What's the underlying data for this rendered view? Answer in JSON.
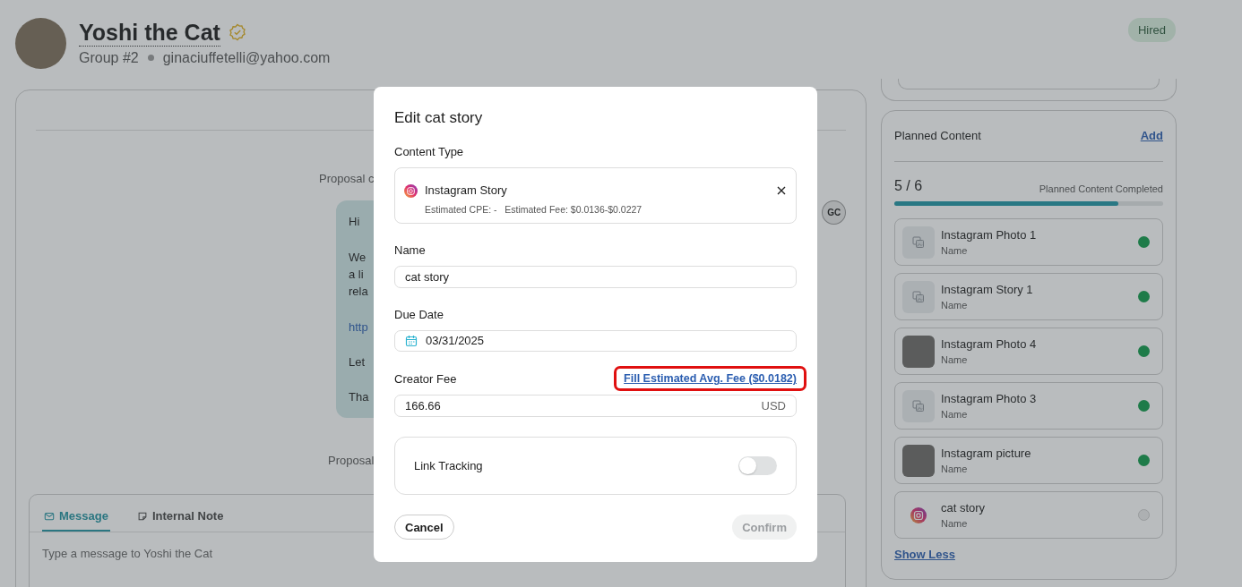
{
  "profile": {
    "name": "Yoshi the Cat",
    "verified": true,
    "group": "Group #2",
    "email": "ginaciuffetelli@yahoo.com",
    "status": "Hired"
  },
  "chat": {
    "event_top": "Proposal c",
    "bubble_lines": [
      "Hi",
      "We",
      "a li",
      "rela",
      "http",
      "Let",
      "Tha"
    ],
    "sender_initials": "GC",
    "event_bottom": "Proposal"
  },
  "composer": {
    "tabs": [
      {
        "label": "Message",
        "kind": "message",
        "selected": true
      },
      {
        "label": "Internal Note",
        "kind": "note",
        "selected": false
      }
    ],
    "placeholder": "Type a message to Yoshi the Cat"
  },
  "planned_content": {
    "title": "Planned Content",
    "add_link": "Add",
    "count": "5 / 6",
    "caption": "Planned Content Completed",
    "level": 0.833,
    "items": [
      {
        "title": "Instagram Photo 1",
        "subtitle": "Name",
        "kind": "placeholder",
        "completed": true
      },
      {
        "title": "Instagram Story 1",
        "subtitle": "Name",
        "kind": "placeholder",
        "completed": true
      },
      {
        "title": "Instagram Photo 4",
        "subtitle": "Name",
        "kind": "photo",
        "completed": true
      },
      {
        "title": "Instagram Photo 3",
        "subtitle": "Name",
        "kind": "placeholder",
        "completed": true
      },
      {
        "title": "Instagram picture",
        "subtitle": "Name",
        "kind": "photo",
        "completed": true
      },
      {
        "title": "cat story",
        "subtitle": "Name",
        "kind": "instagram",
        "completed": false
      }
    ],
    "toggle_link": "Show Less"
  },
  "modal": {
    "title": "Edit cat story",
    "content_type_label": "Content Type",
    "content_type": "Instagram Story",
    "estimate": "Estimated CPE: -   Estimated Fee: $0.0136-$0.0227",
    "name_label": "Name",
    "name_value": "cat story",
    "due_label": "Due Date",
    "due_value": "03/31/2025",
    "fee_label": "Creator Fee",
    "fee_link": "Fill Estimated Avg. Fee ($0.0182)",
    "fee_link_highlighted": true,
    "fee_value": "166.66",
    "currency": "USD",
    "link_tracking_label": "Link Tracking",
    "link_tracking_on": false,
    "cancel": "Cancel",
    "confirm": "Confirm",
    "confirm_disabled": true
  }
}
